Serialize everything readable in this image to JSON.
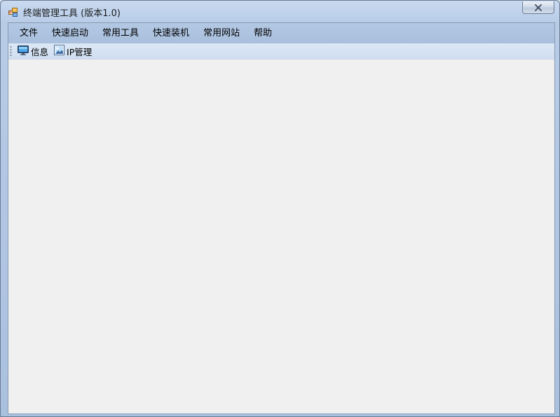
{
  "window": {
    "title": "终端管理工具 (版本1.0)",
    "close_icon": "close-icon",
    "app_icon": "app-icon"
  },
  "menubar": {
    "items": [
      {
        "label": "文件"
      },
      {
        "label": "快速启动"
      },
      {
        "label": "常用工具"
      },
      {
        "label": "快速装机"
      },
      {
        "label": "常用网站"
      },
      {
        "label": "帮助"
      }
    ]
  },
  "toolbar": {
    "items": [
      {
        "label": "信息",
        "icon": "monitor-icon"
      },
      {
        "label": "IP管理",
        "icon": "picture-icon"
      }
    ]
  },
  "colors": {
    "frame": "#b9cde8",
    "menubar": "#aec4e0",
    "toolbar": "#d6e3f3",
    "client": "#f0f0f0"
  }
}
